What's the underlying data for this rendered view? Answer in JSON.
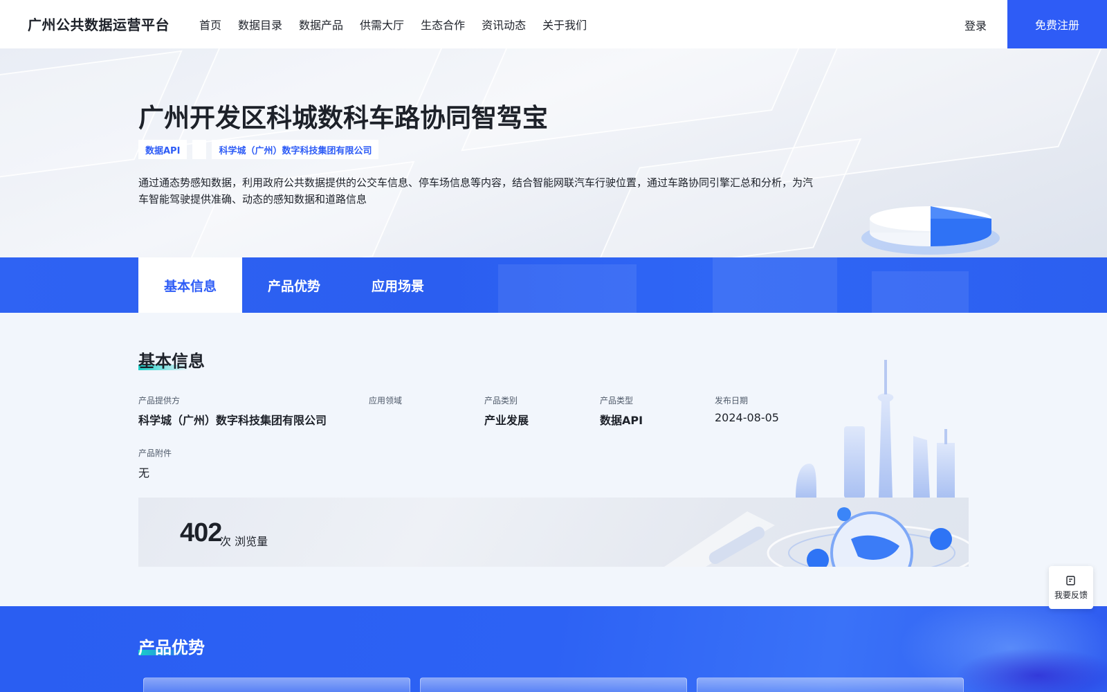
{
  "header": {
    "brand": "广州公共数据运营平台",
    "nav": [
      "首页",
      "数据目录",
      "数据产品",
      "供需大厅",
      "生态合作",
      "资讯动态",
      "关于我们"
    ],
    "login": "登录",
    "register": "免费注册"
  },
  "hero": {
    "title": "广州开发区科城数科车路协同智驾宝",
    "tags": [
      "数据API",
      "",
      "科学城（广州）数字科技集团有限公司"
    ],
    "description": "通过通态势感知数据，利用政府公共数据提供的公交车信息、停车场信息等内容，结合智能网联汽车行驶位置，通过车路协同引擎汇总和分析，为汽车智能驾驶提供准确、动态的感知数据和道路信息"
  },
  "tabs": [
    {
      "label": "基本信息",
      "active": true
    },
    {
      "label": "产品优势",
      "active": false
    },
    {
      "label": "应用场景",
      "active": false
    }
  ],
  "basic_info": {
    "title": "基本信息",
    "provider_label": "产品提供方",
    "provider_value": "科学城（广州）数字科技集团有限公司",
    "domain_label": "应用领域",
    "domain_value": "",
    "category_label": "产品类别",
    "category_value": "产业发展",
    "type_label": "产品类型",
    "type_value": "数据API",
    "date_label": "发布日期",
    "date_value": "2024-08-05",
    "attachment_label": "产品附件",
    "attachment_value": "无",
    "views_count": "402",
    "views_unit": "次 浏览量"
  },
  "feedback": {
    "label": "我要反馈",
    "icon": "feedback-edit-icon"
  },
  "advantages": {
    "title": "产品优势"
  },
  "colors": {
    "primary": "#2e5cf6",
    "accent_teal": "#1ad0c8",
    "text": "#1d2129",
    "page_bg": "#f2f6fc"
  }
}
